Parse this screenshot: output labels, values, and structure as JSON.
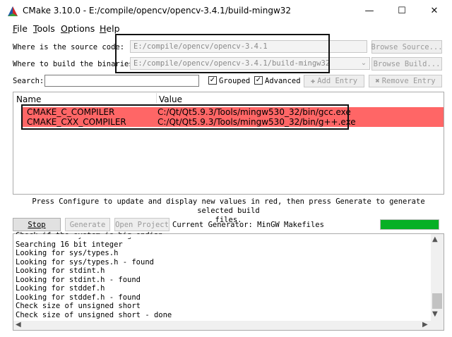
{
  "window": {
    "title": "CMake 3.10.0 - E:/compile/opencv/opencv-3.4.1/build-mingw32",
    "minimize_glyph": "—",
    "maximize_glyph": "☐",
    "close_glyph": "✕"
  },
  "menu": {
    "file": {
      "mnemonic": "F",
      "rest": "ile"
    },
    "tools": {
      "mnemonic": "T",
      "rest": "ools"
    },
    "options": {
      "mnemonic": "O",
      "rest": "ptions"
    },
    "help": {
      "mnemonic": "H",
      "rest": "elp"
    }
  },
  "source": {
    "label": "Where is the source code:",
    "value": "E:/compile/opencv/opencv-3.4.1",
    "browse_label": "Browse Source..."
  },
  "build": {
    "label": "Where to build the binaries:",
    "value": "E:/compile/opencv/opencv-3.4.1/build-mingw32",
    "browse_label": "Browse Build..."
  },
  "search": {
    "label": "Search:",
    "value": ""
  },
  "options_bar": {
    "grouped_label": "Grouped",
    "grouped_checked": true,
    "advanced_label": "Advanced",
    "advanced_checked": true,
    "add_entry_label": "Add Entry",
    "remove_entry_label": "Remove Entry"
  },
  "table": {
    "columns": [
      "Name",
      "Value"
    ],
    "rows": [
      {
        "name": "CMAKE_C_COMPILER",
        "value": "C:/Qt/Qt5.9.3/Tools/mingw530_32/bin/gcc.exe"
      },
      {
        "name": "CMAKE_CXX_COMPILER",
        "value": "C:/Qt/Qt5.9.3/Tools/mingw530_32/bin/g++.exe"
      }
    ]
  },
  "message": {
    "line1": "Press Configure to update and display new values in red, then press Generate to generate selected build",
    "line2": "files."
  },
  "actions": {
    "stop_label": "Stop",
    "generate_label": "Generate",
    "open_project_label": "Open Project",
    "generator_text": "Current Generator: MinGW Makefiles",
    "progress": 1.0
  },
  "output": {
    "lines": [
      "Check if the system is big endian",
      "Searching 16 bit integer",
      "Looking for sys/types.h",
      "Looking for sys/types.h - found",
      "Looking for stdint.h",
      "Looking for stdint.h - found",
      "Looking for stddef.h",
      "Looking for stddef.h - found",
      "Check size of unsigned short",
      "Check size of unsigned short - done"
    ]
  },
  "colors": {
    "changed_row": "#ff6666",
    "progress_fill": "#06b025",
    "annotation_box": "#111111"
  },
  "icons": [
    "cmake-triangle-icon",
    "chevron-down-icon",
    "plus-icon",
    "remove-icon",
    "arrow-up-icon",
    "arrow-down-icon",
    "arrow-left-icon",
    "arrow-right-icon"
  ]
}
